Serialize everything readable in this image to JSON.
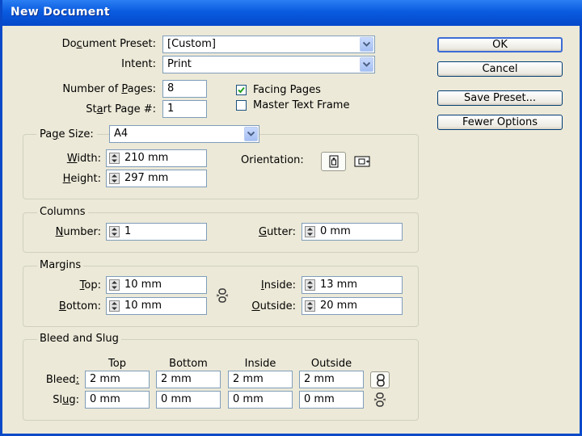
{
  "window": {
    "title": "New Document"
  },
  "document_preset": {
    "label": "Document Preset:",
    "value": "[Custom]"
  },
  "intent": {
    "label": "Intent:",
    "value": "Print"
  },
  "pages": {
    "number_label": "Number of Pages:",
    "number_value": "8",
    "start_label": "Start Page #:",
    "start_value": "1"
  },
  "options": {
    "facing_pages": {
      "label": "Facing Pages",
      "checked": true
    },
    "master_text_frame": {
      "label": "Master Text Frame",
      "checked": false
    }
  },
  "buttons": {
    "ok": "OK",
    "cancel": "Cancel",
    "save_preset": "Save Preset...",
    "fewer_options": "Fewer Options"
  },
  "page_size": {
    "label": "Page Size:",
    "value": "A4",
    "width_label": "Width:",
    "width_value": "210 mm",
    "height_label": "Height:",
    "height_value": "297 mm",
    "orientation_label": "Orientation:"
  },
  "columns": {
    "title": "Columns",
    "number_label": "Number:",
    "number_value": "1",
    "gutter_label": "Gutter:",
    "gutter_value": "0 mm"
  },
  "margins": {
    "title": "Margins",
    "top_label": "Top:",
    "top_value": "10 mm",
    "bottom_label": "Bottom:",
    "bottom_value": "10 mm",
    "inside_label": "Inside:",
    "inside_value": "13 mm",
    "outside_label": "Outside:",
    "outside_value": "20 mm"
  },
  "bleed_slug": {
    "title": "Bleed and Slug",
    "headers": [
      "Top",
      "Bottom",
      "Inside",
      "Outside"
    ],
    "bleed_label": "Bleed:",
    "bleed_values": [
      "2 mm",
      "2 mm",
      "2 mm",
      "2 mm"
    ],
    "slug_label": "Slug:",
    "slug_values": [
      "0 mm",
      "0 mm",
      "0 mm",
      "0 mm"
    ]
  },
  "icons": {
    "spinner": "spinner-arrows-icon",
    "dropdown": "chevron-down-icon",
    "portrait": "portrait-orientation-icon",
    "landscape": "landscape-orientation-icon",
    "link_chain": "chain-link-icon",
    "link_broken": "broken-chain-icon"
  },
  "colors": {
    "titlebar": "#0a5be0",
    "dialog_bg": "#ece9d8",
    "button_border": "#003c74",
    "default_button_border": "#3c6cd5"
  }
}
